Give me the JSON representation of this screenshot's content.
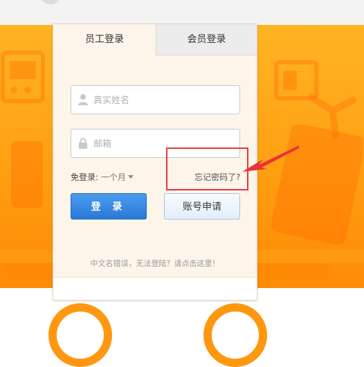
{
  "tabs": {
    "staff_login": "员工登录",
    "member_login": "会员登录"
  },
  "form": {
    "name_placeholder": "真实姓名",
    "email_placeholder": "邮箱",
    "auto_login_label": "免登录:",
    "auto_login_value": "一个月",
    "forgot_password": "忘记密码了?",
    "login_button": "登 录",
    "apply_button": "账号申请",
    "help_link": "中文名错误，无法登陆？请点击这里！"
  },
  "icons": [
    "user-icon",
    "lock-icon",
    "dropdown-caret-icon"
  ],
  "colors": {
    "accent_orange": "#ff9f12",
    "login_blue": "#2a79d6",
    "highlight_red": "#e8333b"
  }
}
